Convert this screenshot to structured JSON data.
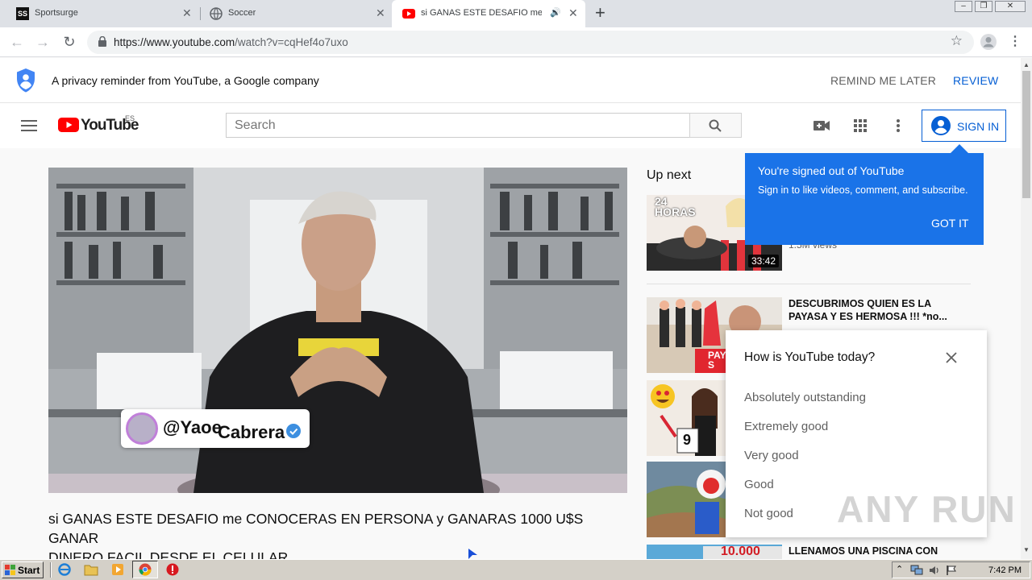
{
  "browser": {
    "tabs": [
      {
        "label": "Sportsurge",
        "favicon": "SS"
      },
      {
        "label": "Soccer"
      },
      {
        "label": "si GANAS ESTE DESAFIO me CO"
      }
    ],
    "address": {
      "scheme_host": "https://www.youtube.com",
      "path": "/watch?v=cqHef4o7uxo"
    }
  },
  "privacy_bar": {
    "text": "A privacy reminder from YouTube, a Google company",
    "later": "REMIND ME LATER",
    "review": "REVIEW"
  },
  "masthead": {
    "logo": "YouTube",
    "region": "ES",
    "search_placeholder": "Search",
    "sign_in": "SIGN IN"
  },
  "video": {
    "overlay_handle_1": "@Yaoe",
    "overlay_handle_2": "Cabrera",
    "title_line1": "si GANAS ESTE DESAFIO me CONOCERAS EN PERSONA y GANARAS 1000 U$S GANAR",
    "title_line2": "DINERO FACIL DESDE EL CELULAR"
  },
  "sidebar": {
    "heading": "Up next",
    "items": [
      {
        "thumb_text": "24 HORAS",
        "duration": "33:42",
        "meta": "1.5M views"
      },
      {
        "title_line1": "DESCUBRIMOS QUIEN ES LA",
        "title_line2": "PAYASA Y ES HERMOSA !!! *no...",
        "meta": "...",
        "thumb_text": "PAYA S"
      },
      {
        "thumb_text": "9"
      },
      {
        "thumb_text": ""
      },
      {
        "title_line1": "LLENAMOS UNA PISCINA CON",
        "thumb_text": "10.000"
      }
    ]
  },
  "tooltip": {
    "title": "You're signed out of YouTube",
    "body": "Sign in to like videos, comment, and subscribe.",
    "button": "GOT IT"
  },
  "survey": {
    "question": "How is YouTube today?",
    "options": [
      "Absolutely outstanding",
      "Extremely good",
      "Very good",
      "Good",
      "Not good"
    ]
  },
  "taskbar": {
    "start": "Start",
    "clock": "7:42 PM"
  },
  "watermark": "ANY RUN",
  "colors": {
    "youtube_red": "#ff0000",
    "accent_blue": "#065fd4",
    "tooltip_blue": "#1a73e8"
  }
}
